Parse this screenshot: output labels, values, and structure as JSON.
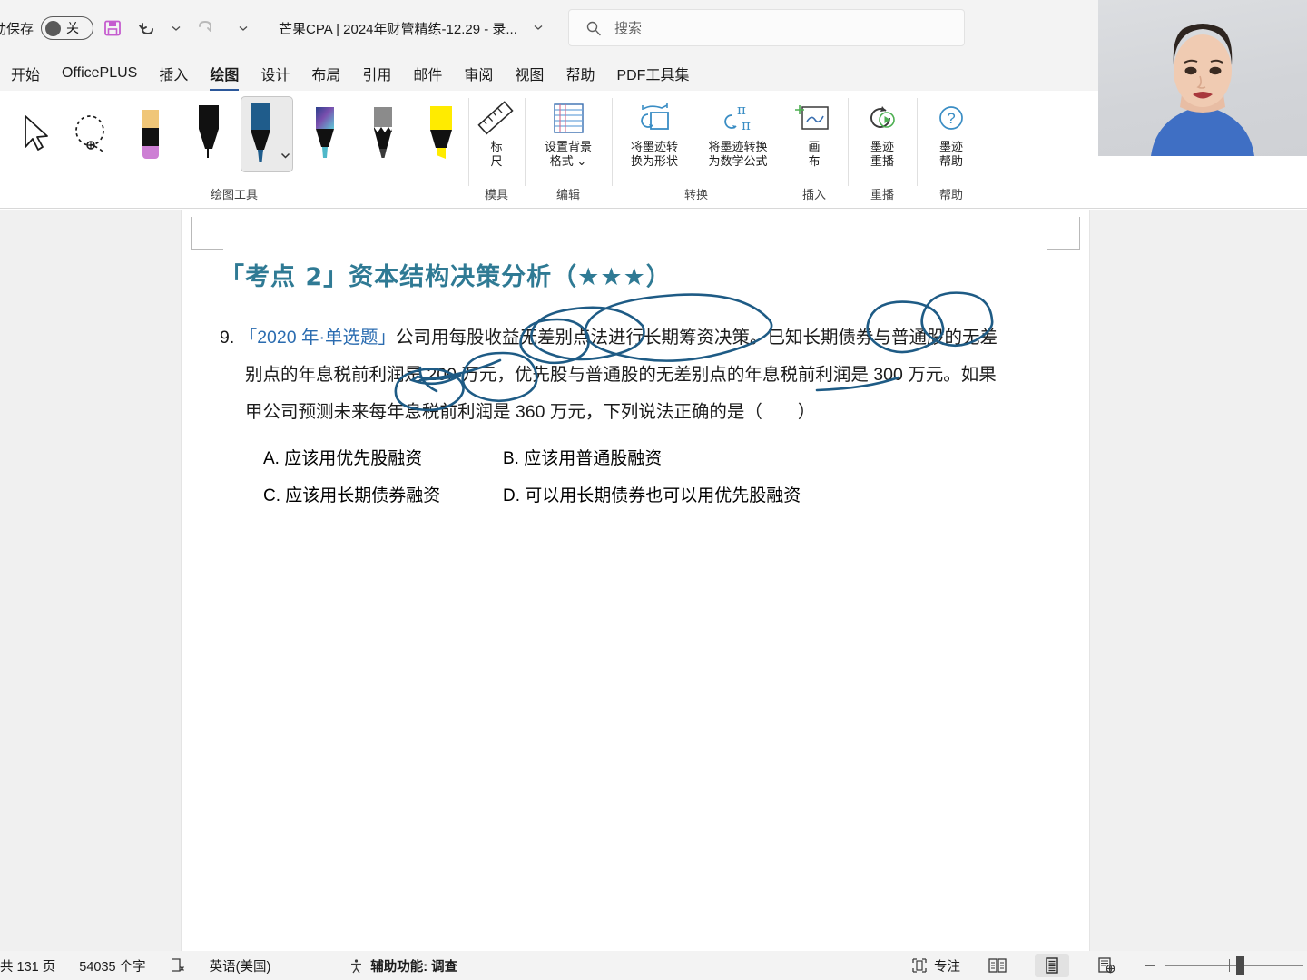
{
  "titlebar": {
    "autosave_label": "动保存",
    "autosave_state": "关",
    "document_title": "芒果CPA | 2024年财管精练-12.29 - 录...",
    "save_icon": "save-icon",
    "undo_icon": "undo-icon",
    "redo_icon": "redo-icon",
    "qat_more_icon": "chevron-down-icon",
    "title_chevron": "chevron-down-icon"
  },
  "search": {
    "placeholder": "搜索",
    "icon": "search-icon"
  },
  "ribbon": {
    "tabs": [
      {
        "label": "开始",
        "active": false
      },
      {
        "label": "OfficePLUS",
        "active": false
      },
      {
        "label": "插入",
        "active": false
      },
      {
        "label": "绘图",
        "active": true
      },
      {
        "label": "设计",
        "active": false
      },
      {
        "label": "布局",
        "active": false
      },
      {
        "label": "引用",
        "active": false
      },
      {
        "label": "邮件",
        "active": false
      },
      {
        "label": "审阅",
        "active": false
      },
      {
        "label": "视图",
        "active": false
      },
      {
        "label": "帮助",
        "active": false
      },
      {
        "label": "PDF工具集",
        "active": false
      }
    ],
    "groups": [
      {
        "name": "绘图工具",
        "label": "绘图工具",
        "tools": [
          {
            "name": "select-object-tool",
            "icon": "cursor-arrow-icon"
          },
          {
            "name": "lasso-select-tool",
            "icon": "lasso-icon"
          },
          {
            "name": "eraser-tool",
            "icon": "eraser-icon"
          },
          {
            "name": "pen-black-tool",
            "icon": "pen-icon",
            "color": "#1a1a1a"
          },
          {
            "name": "pen-blue-tool",
            "icon": "pen-icon",
            "color": "#1f5c8b",
            "selected": true
          },
          {
            "name": "pen-galaxy-tool",
            "icon": "pen-icon",
            "color": "#3f6fa8"
          },
          {
            "name": "pencil-tool",
            "icon": "pencil-icon",
            "color": "#888888"
          },
          {
            "name": "highlighter-yellow-tool",
            "icon": "highlighter-icon",
            "color": "#ffeb00"
          }
        ]
      },
      {
        "name": "模具",
        "label": "模具",
        "commands": [
          {
            "name": "ruler-button",
            "label": "标\n尺",
            "icon": "ruler-icon"
          }
        ]
      },
      {
        "name": "编辑",
        "label": "编辑",
        "commands": [
          {
            "name": "set-background-format-button",
            "label": "设置背景\n格式 ⌄",
            "icon": "background-format-icon"
          }
        ]
      },
      {
        "name": "转换",
        "label": "转换",
        "commands": [
          {
            "name": "ink-to-shape-button",
            "label": "将墨迹转\n换为形状",
            "icon": "ink-to-shape-icon"
          },
          {
            "name": "ink-to-math-button",
            "label": "将墨迹转换\n为数学公式",
            "icon": "ink-to-math-icon"
          }
        ]
      },
      {
        "name": "插入",
        "label": "插入",
        "commands": [
          {
            "name": "drawing-canvas-button",
            "label": "画\n布",
            "icon": "canvas-icon"
          }
        ]
      },
      {
        "name": "重播",
        "label": "重播",
        "commands": [
          {
            "name": "ink-replay-button",
            "label": "墨迹\n重播",
            "icon": "replay-icon"
          }
        ]
      },
      {
        "name": "帮助",
        "label": "帮助",
        "commands": [
          {
            "name": "ink-help-button",
            "label": "墨迹\n帮助",
            "icon": "question-circle-icon"
          }
        ]
      }
    ]
  },
  "document": {
    "heading": "「考点 2」资本结构决策分析（★★★）",
    "heading_color": "#2f7a94",
    "question": {
      "number": "9.",
      "tag": "「2020 年·单选题」",
      "tag_color": "#2b6cb0",
      "line1_rest": "公司用每股收益无差别点法进行长期筹资决策。已知长期债券与普通股的无差",
      "line2": "别点的年息税前利润是 200 万元，优先股与普通股的无差别点的年息税前利润是 300 万元。如果",
      "line3": "甲公司预测未来每年息税前利润是 360 万元，下列说法正确的是（　　）"
    },
    "options": [
      {
        "key": "A.",
        "text": "应该用优先股融资"
      },
      {
        "key": "B.",
        "text": "应该用普通股融资"
      },
      {
        "key": "C.",
        "text": "应该用长期债券融资"
      },
      {
        "key": "D.",
        "text": "可以用长期债券也可以用优先股融资"
      }
    ],
    "ink_color": "#1e5b85"
  },
  "statusbar": {
    "page_count": "共 131 页",
    "word_count": "54035 个字",
    "proofing_icon": "proofing-errors-icon",
    "language": "英语(美国)",
    "accessibility_icon": "accessibility-icon",
    "accessibility_label": "辅助功能: 调查",
    "focus_icon": "focus-mode-icon",
    "focus_label": "专注",
    "views": [
      {
        "name": "read-mode-button",
        "icon": "read-mode-icon",
        "active": false
      },
      {
        "name": "print-layout-button",
        "icon": "print-layout-icon",
        "active": true
      },
      {
        "name": "web-layout-button",
        "icon": "web-layout-icon",
        "active": false
      }
    ],
    "zoom_out_icon": "minus-icon"
  },
  "webcam": {
    "name": "webcam-overlay"
  }
}
